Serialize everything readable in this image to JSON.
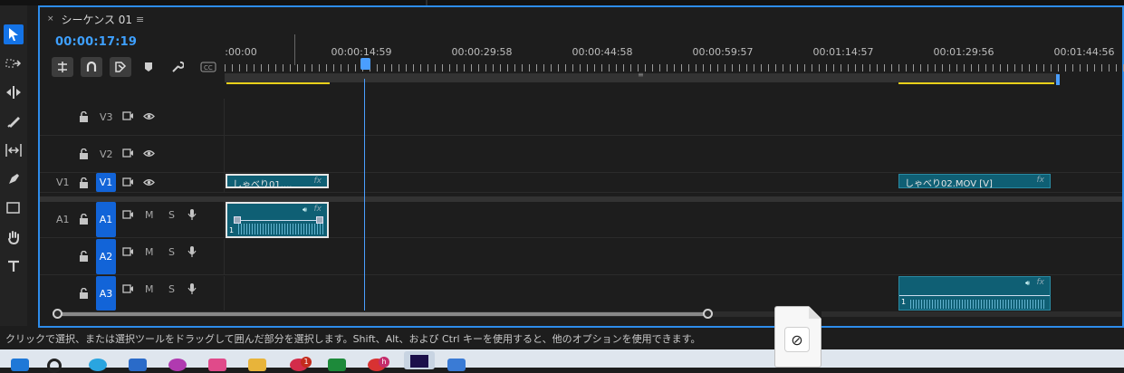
{
  "panel": {
    "tab_close": "×",
    "title": "シーケンス 01",
    "menu": "≡"
  },
  "timecode": "00:00:17:19",
  "ruler": {
    "labels": [
      ":00:00",
      "00:00:14:59",
      "00:00:29:58",
      "00:00:44:58",
      "00:00:59:57",
      "00:01:14:57",
      "00:01:29:56",
      "00:01:44:56"
    ],
    "center_mark": "≡"
  },
  "tracks": {
    "v3": {
      "name": "V3"
    },
    "v2": {
      "name": "V2"
    },
    "v1": {
      "source": "V1",
      "name": "V1"
    },
    "a1": {
      "source": "A1",
      "name": "A1",
      "m": "M",
      "s": "S"
    },
    "a2": {
      "name": "A2",
      "m": "M",
      "s": "S"
    },
    "a3": {
      "name": "A3",
      "m": "M",
      "s": "S"
    }
  },
  "clips": {
    "v1a": {
      "name": "しゃべり01....",
      "fx": "fx"
    },
    "v1b": {
      "name": "しゃべり02.MOV [V]",
      "fx": "fx"
    },
    "a1a": {
      "fx": "fx",
      "num": "1"
    },
    "a3b": {
      "fx": "fx",
      "num": "1"
    }
  },
  "status": "クリックで選択、または選択ツールをドラッグして囲んだ部分を選択します。Shift、Alt、および Ctrl キーを使用すると、他のオプションを使用できます。",
  "taskbar": {
    "badge1": "1",
    "badge2": "h"
  },
  "colors": {
    "accent": "#2d8ceb",
    "target": "#1264d8",
    "clip": "#0f5f74",
    "inout": "#e8d01a",
    "playhead": "#4a9eff"
  }
}
